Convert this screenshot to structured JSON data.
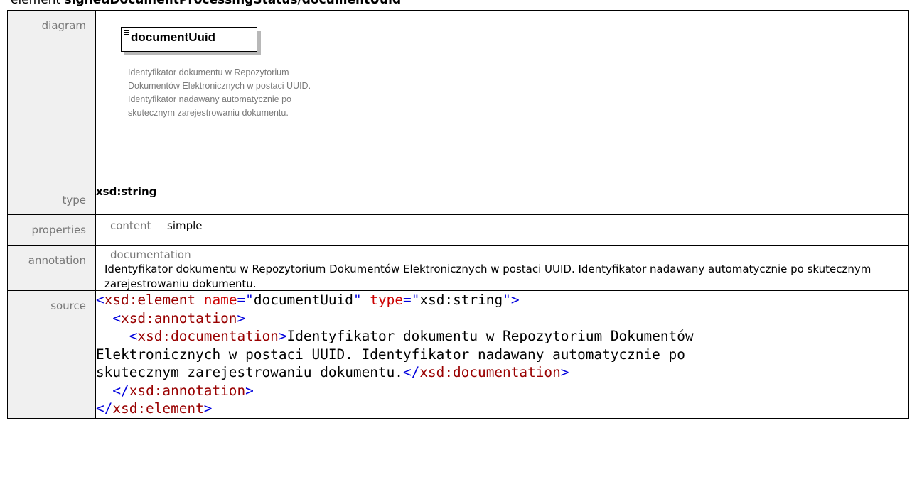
{
  "heading": {
    "prefix": "element",
    "path": "signedDocumentProcessingStatus/documentUuid"
  },
  "rows": {
    "diagram": {
      "label": "diagram",
      "box_title": "documentUuid",
      "description": "Identyfikator dokumentu w Repozytorium Dokumentów Elektronicznych w postaci UUID. Identyfikator nadawany automatycznie po skutecznym zarejestrowaniu dokumentu."
    },
    "type": {
      "label": "type",
      "value": "xsd:string"
    },
    "properties": {
      "label": "properties",
      "key": "content",
      "value": "simple"
    },
    "annotation": {
      "label": "annotation",
      "key": "documentation",
      "text": "Identyfikator dokumentu w Repozytorium Dokumentów Elektronicznych w postaci UUID. Identyfikator nadawany automatycznie po skutecznym zarejestrowaniu dokumentu."
    },
    "source": {
      "label": "source",
      "element_tag": "xsd:element",
      "attr_name": "name",
      "attr_name_value": "documentUuid",
      "attr_type": "type",
      "attr_type_value": "xsd:string",
      "annotation_tag": "xsd:annotation",
      "documentation_tag": "xsd:documentation",
      "doc_line1": "Identyfikator dokumentu w Repozytorium Dokumentów",
      "doc_line2": "Elektronicznych w postaci UUID. Identyfikator nadawany automatycznie po",
      "doc_line3": "skutecznym zarejestrowaniu dokumentu."
    }
  },
  "colors": {
    "label_bg": "#f0f0f0",
    "label_text": "#777777",
    "xml_tag": "#990000",
    "xml_attr": "#cc0000",
    "xml_punct": "#0000dd"
  }
}
